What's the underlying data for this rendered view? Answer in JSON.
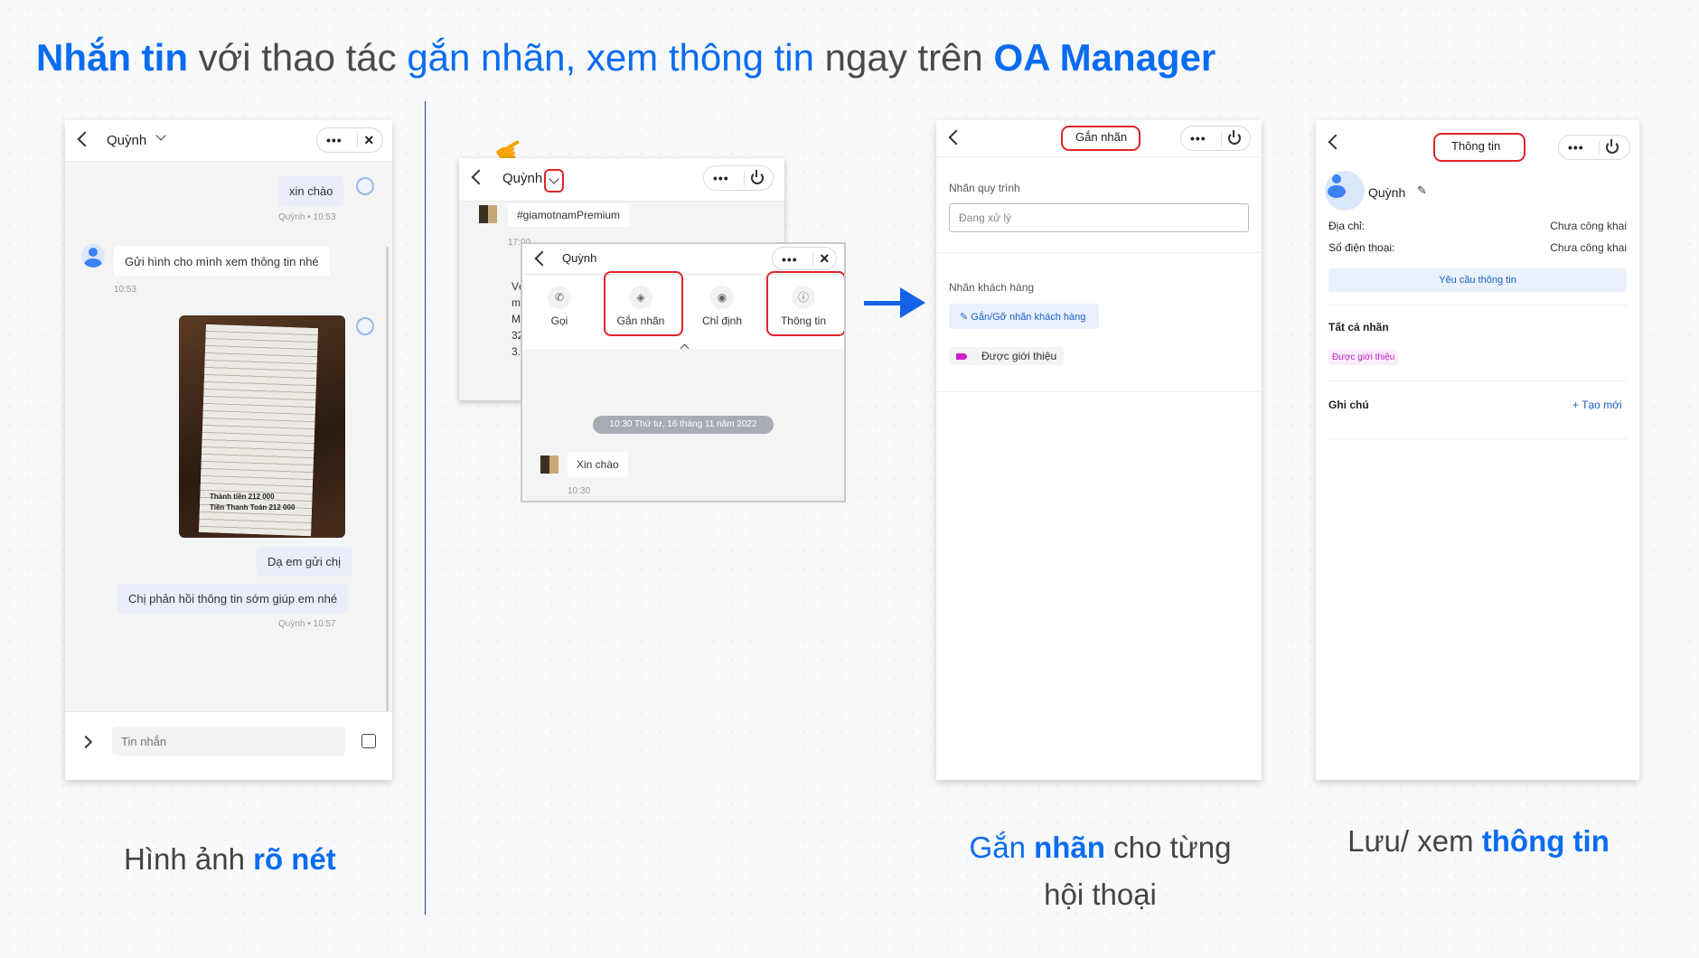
{
  "headline": {
    "p1": "Nhắn tin",
    "p2": " với thao tác ",
    "p3": "gắn nhãn, xem thông tin",
    "p4": " ngay trên ",
    "p5": "OA Manager"
  },
  "colors": {
    "accent": "#0a6cf0",
    "highlight_box": "#e0232a",
    "tag_pink": "#d01dd0"
  },
  "panel1": {
    "header_name": "Quỳnh",
    "messages": [
      {
        "text": "xin chào",
        "meta": "Quỳnh • 10:53"
      },
      {
        "text": "Gửi hình cho mình xem thông tin nhé",
        "meta": "10:53"
      },
      {
        "text": "Dạ em gửi chị"
      },
      {
        "text": "Chị phản hồi thông tin sớm giúp em nhé",
        "meta": "Quỳnh • 10:57"
      }
    ],
    "receipt_total_1": "Thành tiền  212 000",
    "receipt_total_2": "Tiền Thanh Toán  212 000",
    "input_placeholder": "Tin nhắn",
    "caption_a": "Hình ảnh ",
    "caption_b": "rõ nét"
  },
  "panel2": {
    "back_name": "Quỳnh",
    "hashtag": "#giamotnamPremium",
    "back_time": "17:00",
    "back_preview": [
      "Vé",
      "m",
      "M",
      "32",
      "3."
    ],
    "front_name": "Quỳnh",
    "actions": [
      "Gọi",
      "Gắn nhãn",
      "Chỉ định",
      "Thông tin"
    ],
    "action_icons": [
      "phone-icon",
      "tag-icon",
      "assign-icon",
      "info-icon"
    ],
    "date_pill": "10:30 Thứ tư, 16 tháng 11 năm 2022",
    "message": "Xin chào",
    "message_time": "10:30"
  },
  "panel3": {
    "header_title": "Gắn nhãn",
    "process_label": "Nhãn quy trình",
    "process_value": "Đang xử lý",
    "customer_label": "Nhãn khách hàng",
    "toggle_button": "Gắn/Gỡ nhãn khách hàng",
    "tag": "Được giới thiệu",
    "caption_a": "Gắn ",
    "caption_b": "nhãn",
    "caption_c": " cho từng",
    "caption_d": "hội thoại"
  },
  "panel4": {
    "header_title": "Thông tin",
    "name": "Quỳnh",
    "address_label": "Địa chỉ:",
    "address_value": "Chưa công khai",
    "phone_label": "Số điện thoại:",
    "phone_value": "Chưa công khai",
    "request_button": "Yêu cầu thông tin",
    "all_tags_label": "Tất cả nhãn",
    "tag": "Được giới thiệu",
    "notes_label": "Ghi chú",
    "new_note": "+  Tạo mới",
    "caption_a": "Lưu/ xem ",
    "caption_b": "thông tin"
  }
}
